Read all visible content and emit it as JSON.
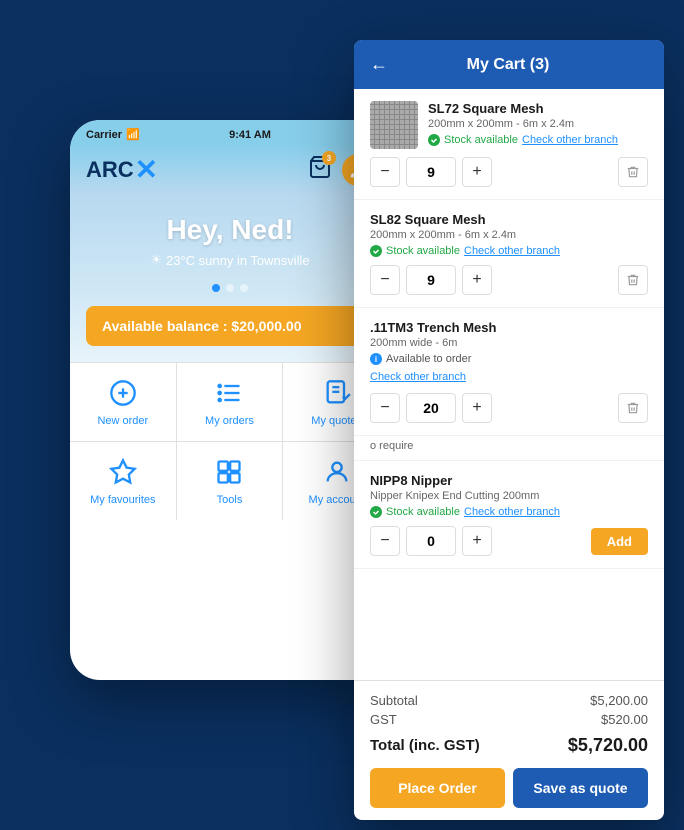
{
  "mobile": {
    "status": {
      "carrier": "Carrier",
      "time": "9:41 AM",
      "wifi": "wifi"
    },
    "logo": {
      "arc": "ARC",
      "x": "X"
    },
    "cart_badge": "3",
    "hero": {
      "greeting": "Hey, Ned!",
      "weather": "23°C sunny in Townsville",
      "sun_icon": "☀"
    },
    "balance": {
      "label": "Available balance : $20,000.00",
      "arrow": "›"
    },
    "grid_items": [
      {
        "icon": "new-order-icon",
        "label": "New order"
      },
      {
        "icon": "my-orders-icon",
        "label": "My orders"
      },
      {
        "icon": "my-quotes-icon",
        "label": "My quotes"
      },
      {
        "icon": "my-favourites-icon",
        "label": "My favourites"
      },
      {
        "icon": "tools-icon",
        "label": "Tools"
      },
      {
        "icon": "my-account-icon",
        "label": "My account"
      }
    ]
  },
  "cart": {
    "header": {
      "title": "My Cart (3)",
      "back_icon": "←"
    },
    "items": [
      {
        "name": "SL72 Square Mesh",
        "spec": "200mm x 200mm - 6m x 2.4m",
        "status": "stock",
        "status_text": "Stock available",
        "branch_link": "Check other branch",
        "quantity": "9",
        "has_thumb": true
      },
      {
        "name": "SL82 Square Mesh",
        "spec": "200mm x 200mm - 6m x 2.4m",
        "status": "stock",
        "status_text": "Stock available",
        "branch_link": "Check other branch",
        "quantity": "9",
        "has_thumb": false
      },
      {
        "name": ".11TM3 Trench Mesh",
        "spec": "200mm wide - 6m",
        "status": "order",
        "status_text": "Available to order",
        "branch_link": "Check other branch",
        "quantity": "20",
        "has_thumb": false
      }
    ],
    "require_note": "o require",
    "bonus_item": {
      "name": "NIPP8 Nipper",
      "spec": "Nipper Knipex End Cutting 200mm",
      "status": "stock",
      "status_text": "Stock available",
      "branch_link": "Check other branch",
      "quantity": "0",
      "add_label": "Add"
    },
    "subtotal_label": "Subtotal",
    "subtotal_amount": "$5,200.00",
    "gst_label": "GST",
    "gst_amount": "$520.00",
    "total_label": "Total (inc. GST)",
    "total_amount": "$5,720.00",
    "btn_place_order": "Place Order",
    "btn_save_quote": "Save as quote"
  }
}
